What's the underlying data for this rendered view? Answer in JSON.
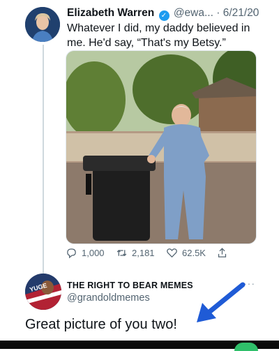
{
  "tweet": {
    "author_name": "Elizabeth Warren",
    "handle": "@ewa...",
    "separator": "·",
    "date": "6/21/20",
    "more": "···",
    "text": "Whatever I did, my daddy believed in me. He'd say, “That's my Betsy.”",
    "icons": {
      "verified": "verified-badge-icon",
      "reply": "reply-icon",
      "retweet": "retweet-icon",
      "like": "heart-icon",
      "share": "share-icon"
    },
    "stats": {
      "replies": "1,000",
      "retweets": "2,181",
      "likes": "62.5K"
    }
  },
  "reply": {
    "author_name": "THE RIGHT TO BEAR MEMES",
    "handle": "@grandoldmemes",
    "more": "···",
    "text": "Great picture of you two!",
    "avatar_text": "YUGE"
  },
  "colors": {
    "accent": "#1d9bf0",
    "arrow": "#1f5bd6",
    "muted": "#536471"
  }
}
